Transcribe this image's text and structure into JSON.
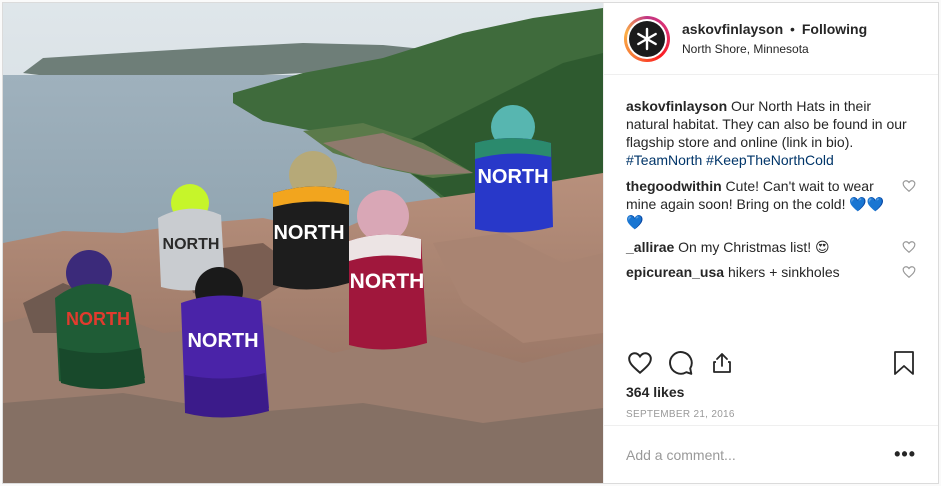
{
  "post": {
    "photo": {
      "alt": "",
      "hats": [
        {
          "label": "NORTH",
          "color": "#1f5c36",
          "pom": "#3b2a7a",
          "text": "#e23b2e"
        },
        {
          "label": "NORTH",
          "color": "#c9ccd0",
          "pom": "#c6f52a",
          "text": "#2a2a2a"
        },
        {
          "label": "NORTH",
          "color": "#4a23a8",
          "pom": "#1a1a1a",
          "text": "#ffffff"
        },
        {
          "label": "NORTH",
          "color": "#1d1d1d",
          "pom": "#b6a978",
          "text": "#ffffff"
        },
        {
          "label": "NORTH",
          "color": "#a0173c",
          "pom": "#d9a7b6",
          "text": "#ffffff"
        },
        {
          "label": "NORTH",
          "color": "#2838c9",
          "pom": "#57b6b0",
          "text": "#ffffff"
        }
      ]
    },
    "header": {
      "username": "askovfinlayson",
      "separator": "•",
      "follow_status": "Following",
      "location": "North Shore, Minnesota"
    },
    "caption": {
      "username": "askovfinlayson",
      "text": "Our North Hats in their natural habitat. They can also be found in our flagship store and online (link in bio).",
      "hashtags": [
        "#TeamNorth",
        "#KeepTheNorthCold"
      ]
    },
    "comments": [
      {
        "username": "thegoodwithin",
        "text": "Cute! Can't wait to wear mine again soon! Bring on the cold! 💙💙💙"
      },
      {
        "username": "_allirae",
        "text": "On my Christmas list! 😍"
      },
      {
        "username": "epicurean_usa",
        "text": "hikers + sinkholes"
      }
    ],
    "actions": {
      "icons": [
        "heart-icon",
        "comment-icon",
        "share-icon",
        "bookmark-icon"
      ]
    },
    "likes": "364 likes",
    "date": "SEPTEMBER 21, 2016",
    "add_comment": {
      "placeholder": "Add a comment...",
      "more": "•••"
    },
    "colors": {
      "link": "#003569",
      "muted": "#999999",
      "border": "#dbdbdb"
    }
  }
}
